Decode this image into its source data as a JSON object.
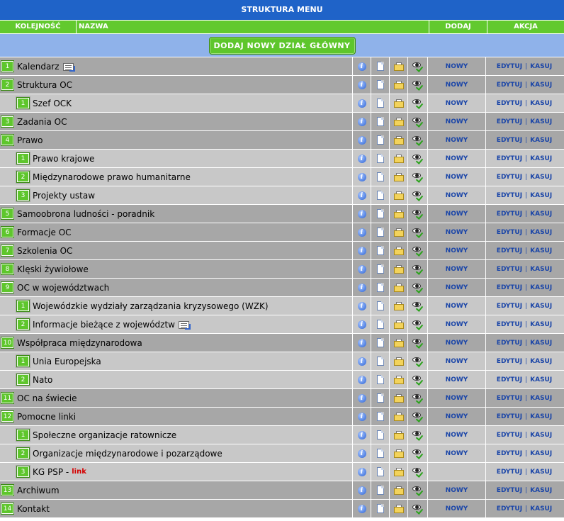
{
  "title": "STRUKTURA MENU",
  "columns": {
    "order": "KOLEJNOŚĆ",
    "name": "NAZWA",
    "add": "DODAJ",
    "action": "AKCJA"
  },
  "add_main_button": "DODAJ NOWY DZIAŁ GŁÓWNY",
  "labels": {
    "new": "NOWY",
    "edit": "EDYTUJ",
    "delete": "KASUJ",
    "separator": "|"
  },
  "icons": [
    "info-icon",
    "page-icon",
    "folder-icon",
    "visible-icon"
  ],
  "rows": [
    {
      "level": "top",
      "num": "1",
      "name": "Kalendarz",
      "external": true,
      "new": "NOWY"
    },
    {
      "level": "top",
      "num": "2",
      "name": "Struktura OC",
      "new": "NOWY"
    },
    {
      "level": "sub",
      "num": "1",
      "name": "Szef OCK",
      "new": "NOWY"
    },
    {
      "level": "top",
      "num": "3",
      "name": "Zadania OC",
      "new": "NOWY"
    },
    {
      "level": "top",
      "num": "4",
      "name": "Prawo",
      "new": "NOWY"
    },
    {
      "level": "sub",
      "num": "1",
      "name": "Prawo krajowe",
      "new": "NOWY"
    },
    {
      "level": "sub",
      "num": "2",
      "name": "Międzynarodowe prawo humanitarne",
      "new": "NOWY"
    },
    {
      "level": "sub",
      "num": "3",
      "name": "Projekty ustaw",
      "new": "NOWY"
    },
    {
      "level": "top",
      "num": "5",
      "name": "Samoobrona ludności - poradnik",
      "new": "NOWY"
    },
    {
      "level": "top",
      "num": "6",
      "name": "Formacje OC",
      "new": "NOWY"
    },
    {
      "level": "top",
      "num": "7",
      "name": "Szkolenia OC",
      "new": "NOWY"
    },
    {
      "level": "top",
      "num": "8",
      "name": "Klęski żywiołowe",
      "new": "NOWY"
    },
    {
      "level": "top",
      "num": "9",
      "name": "OC w województwach",
      "new": "NOWY"
    },
    {
      "level": "sub",
      "num": "1",
      "name": "Wojewódzkie wydziały zarządzania kryzysowego (WZK)",
      "new": "NOWY"
    },
    {
      "level": "sub",
      "num": "2",
      "name": "Informacje bieżące z województw",
      "external": true,
      "new": "NOWY"
    },
    {
      "level": "top",
      "num": "10",
      "name": "Współpraca międzynarodowa",
      "new": "NOWY"
    },
    {
      "level": "sub",
      "num": "1",
      "name": "Unia Europejska",
      "new": "NOWY"
    },
    {
      "level": "sub",
      "num": "2",
      "name": "Nato",
      "new": "NOWY"
    },
    {
      "level": "top",
      "num": "11",
      "name": "OC na świecie",
      "new": "NOWY"
    },
    {
      "level": "top",
      "num": "12",
      "name": "Pomocne linki",
      "new": "NOWY"
    },
    {
      "level": "sub",
      "num": "1",
      "name": "Społeczne organizacje ratownicze",
      "new": "NOWY"
    },
    {
      "level": "sub",
      "num": "2",
      "name": "Organizacje międzynarodowe i pozarządowe",
      "new": "NOWY"
    },
    {
      "level": "sub",
      "num": "3",
      "name": "KG PSP -",
      "link": "link",
      "new": ""
    },
    {
      "level": "top",
      "num": "13",
      "name": "Archiwum",
      "new": "NOWY"
    },
    {
      "level": "top",
      "num": "14",
      "name": "Kontakt",
      "new": "NOWY"
    }
  ]
}
